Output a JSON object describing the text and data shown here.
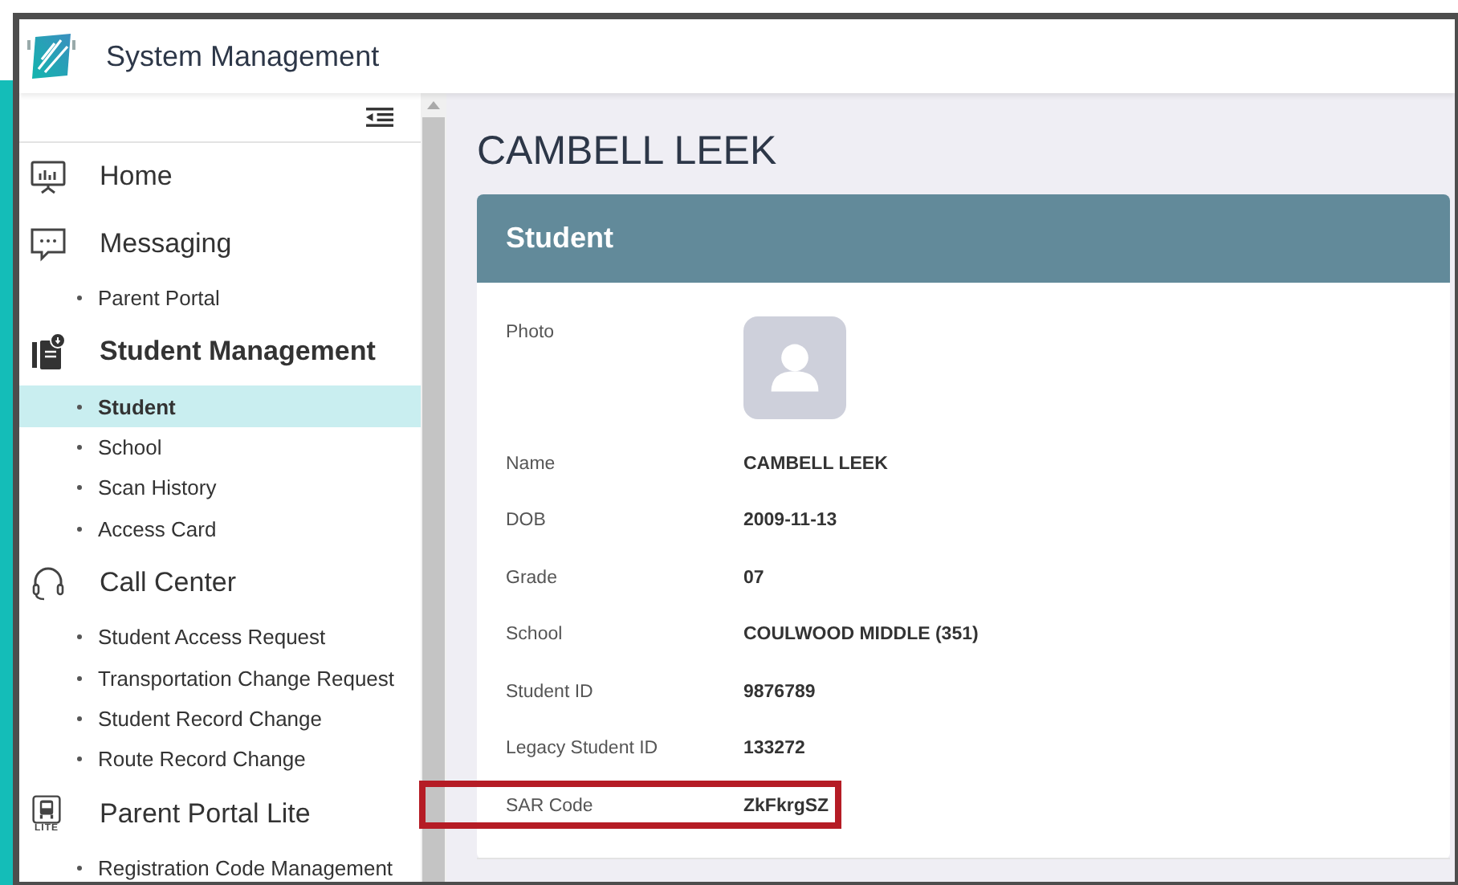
{
  "app": {
    "title": "System Management"
  },
  "sidebar": {
    "groups": [
      {
        "label": "Home",
        "kind": "chart",
        "bold": false
      },
      {
        "label": "Messaging",
        "kind": "chat",
        "bold": false,
        "children": [
          {
            "label": "Parent Portal",
            "selected": false
          }
        ]
      },
      {
        "label": "Student Management",
        "kind": "book",
        "bold": true,
        "children": [
          {
            "label": "Student",
            "selected": true
          },
          {
            "label": "School",
            "selected": false
          },
          {
            "label": "Scan History",
            "selected": false
          },
          {
            "label": "Access Card",
            "selected": false
          }
        ]
      },
      {
        "label": "Call Center",
        "kind": "headset",
        "bold": false,
        "children": [
          {
            "label": "Student Access Request",
            "selected": false
          },
          {
            "label": "Transportation Change Request",
            "selected": false
          },
          {
            "label": "Student Record Change",
            "selected": false
          },
          {
            "label": "Route Record Change",
            "selected": false
          }
        ]
      },
      {
        "label": "Parent Portal Lite",
        "kind": "bus",
        "bold": false,
        "badge": "LITE",
        "children": [
          {
            "label": "Registration Code Management",
            "selected": false
          }
        ]
      }
    ]
  },
  "page": {
    "title": "CAMBELL LEEK"
  },
  "card": {
    "title": "Student",
    "rows": [
      {
        "label": "Photo",
        "kind": "photo",
        "highlighted": false
      },
      {
        "label": "Name",
        "value": "CAMBELL LEEK",
        "kind": "text",
        "highlighted": false
      },
      {
        "label": "DOB",
        "value": "2009-11-13",
        "kind": "text",
        "highlighted": false
      },
      {
        "label": "Grade",
        "value": "07",
        "kind": "text",
        "highlighted": false
      },
      {
        "label": "School",
        "value": "COULWOOD MIDDLE (351)",
        "kind": "text",
        "highlighted": false
      },
      {
        "label": "Student ID",
        "value": "9876789",
        "kind": "text",
        "highlighted": false
      },
      {
        "label": "Legacy Student ID",
        "value": "133272",
        "kind": "text",
        "highlighted": false
      },
      {
        "label": "SAR Code",
        "value": "ZkFkrgSZ",
        "kind": "text",
        "highlighted": true
      }
    ]
  }
}
